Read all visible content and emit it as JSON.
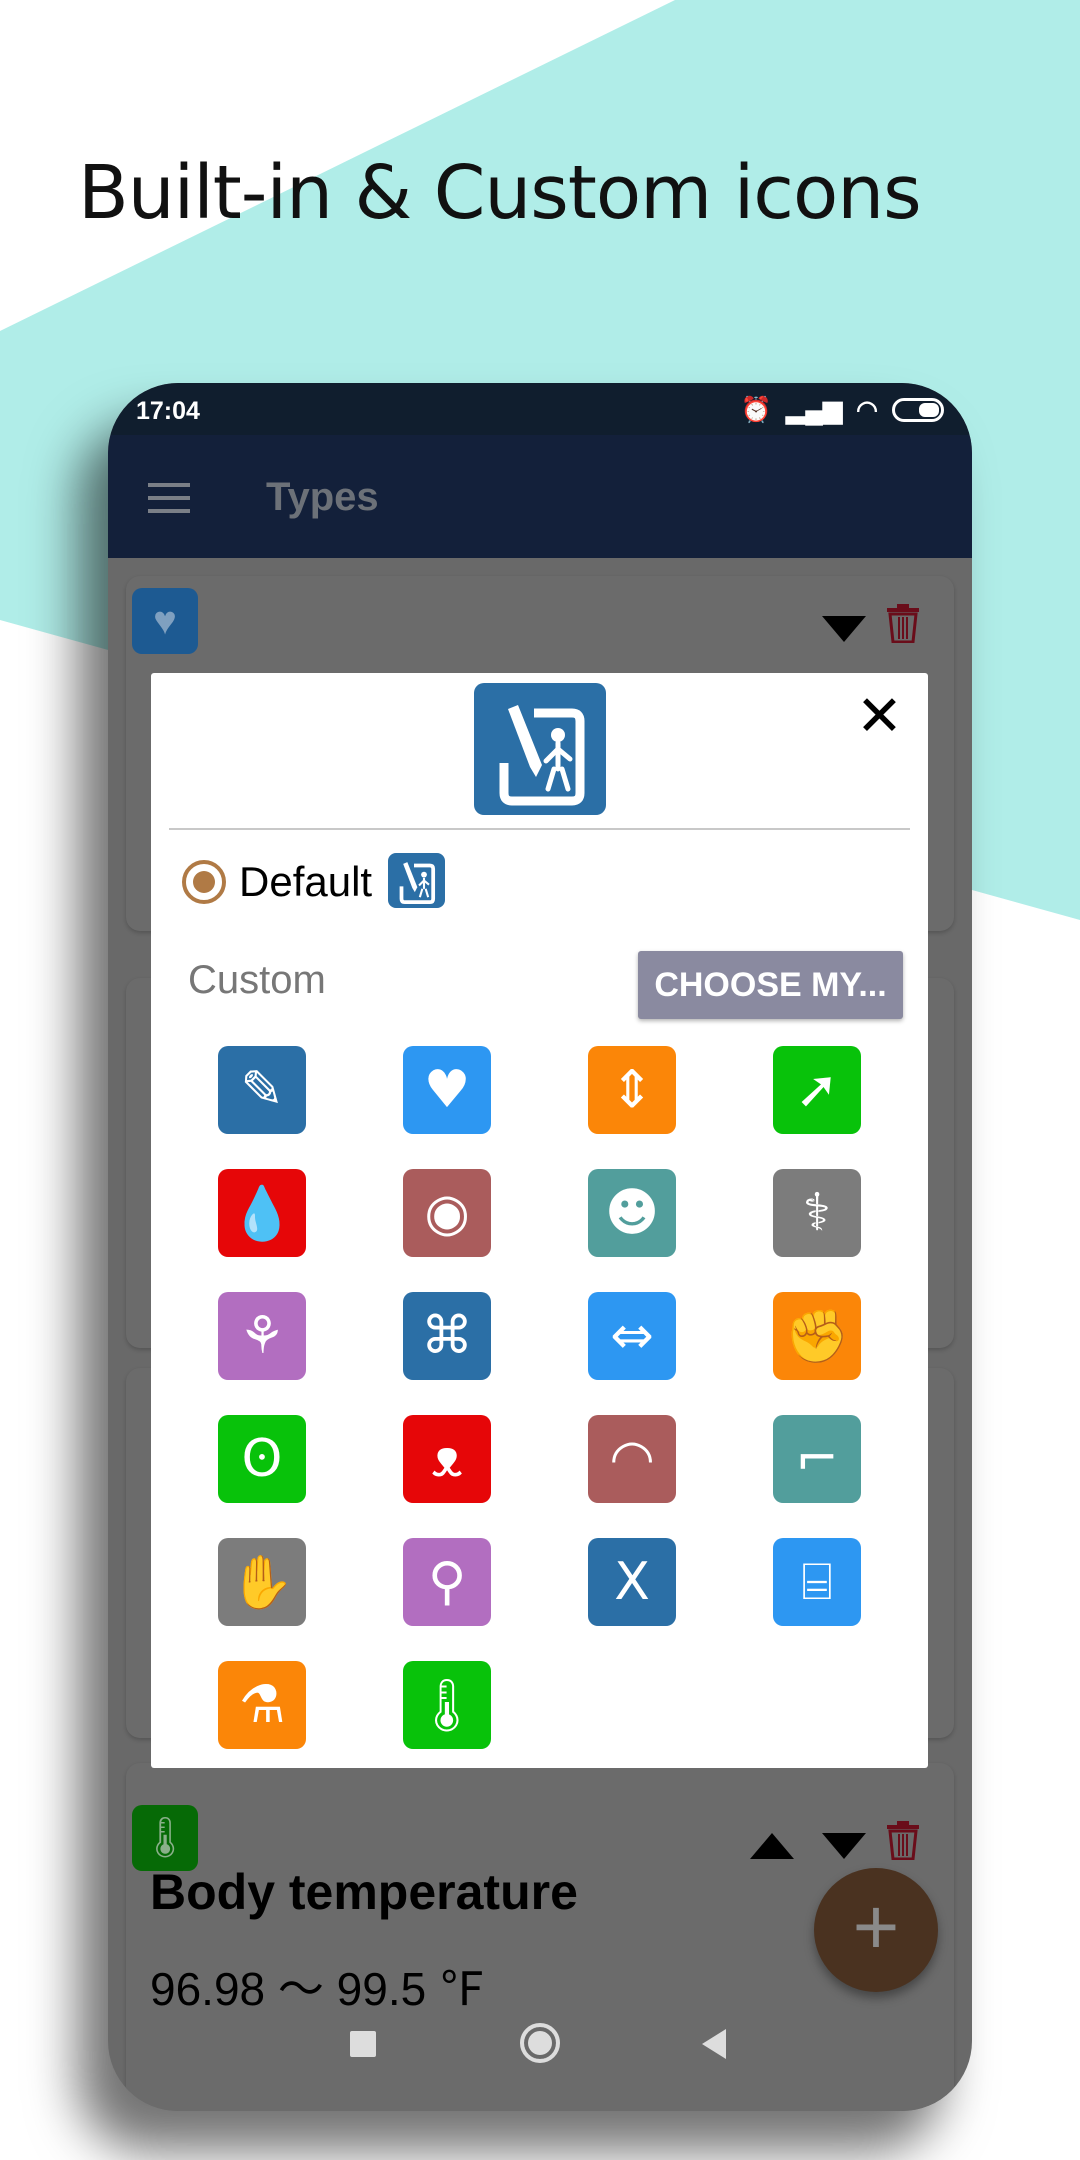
{
  "headline": "Built-in & Custom icons",
  "colors": {
    "teal_band": "#b0ede8",
    "app_bar": "#13203a",
    "status_bar": "#101e2e",
    "radio": "#b07a45",
    "fab": "#4a3220",
    "trash": "#6a0d1a"
  },
  "status_bar": {
    "time": "17:04",
    "icons": [
      "alarm-icon",
      "signal-icon",
      "wifi-icon",
      "battery-icon"
    ]
  },
  "app_bar": {
    "title": "Types",
    "menu_icon": "hamburger-icon"
  },
  "dialog": {
    "close_label": "✕",
    "default_label": "Default",
    "custom_label": "Custom",
    "choose_button": "CHOOSE MY...",
    "icons": [
      {
        "name": "body-chart",
        "color": "#2b6fa6",
        "glyph": "✎"
      },
      {
        "name": "heart-rate",
        "color": "#2d97f2",
        "glyph": "♥"
      },
      {
        "name": "height",
        "color": "#fb8608",
        "glyph": "⇕"
      },
      {
        "name": "compass",
        "color": "#08c20a",
        "glyph": "➚"
      },
      {
        "name": "blood-drops",
        "color": "#e60608",
        "glyph": "💧"
      },
      {
        "name": "eye",
        "color": "#aa5c5c",
        "glyph": "◉"
      },
      {
        "name": "head",
        "color": "#529e9c",
        "glyph": "☻"
      },
      {
        "name": "organs",
        "color": "#7c7c7c",
        "glyph": "⚕"
      },
      {
        "name": "lungs",
        "color": "#b26ec0",
        "glyph": "⚘"
      },
      {
        "name": "intestine",
        "color": "#2b6fa6",
        "glyph": "⌘"
      },
      {
        "name": "waist",
        "color": "#2d97f2",
        "glyph": "⇔"
      },
      {
        "name": "muscle",
        "color": "#fb8608",
        "glyph": "✊"
      },
      {
        "name": "ear",
        "color": "#08c20a",
        "glyph": "ʘ"
      },
      {
        "name": "nose",
        "color": "#e60608",
        "glyph": "ᴥ"
      },
      {
        "name": "lips",
        "color": "#aa5c5c",
        "glyph": "◠"
      },
      {
        "name": "leg",
        "color": "#529e9c",
        "glyph": "⌐"
      },
      {
        "name": "hand",
        "color": "#7c7c7c",
        "glyph": "✋"
      },
      {
        "name": "syringe",
        "color": "#b26ec0",
        "glyph": "⚲"
      },
      {
        "name": "xray",
        "color": "#2b6fa6",
        "glyph": "X"
      },
      {
        "name": "scanner",
        "color": "#2d97f2",
        "glyph": "⌸"
      },
      {
        "name": "test-tube",
        "color": "#fb8608",
        "glyph": "⚗"
      },
      {
        "name": "body-temperature",
        "color": "#08c20a",
        "glyph": "🌡"
      }
    ]
  },
  "cards": [
    {
      "icon": "heart-rate-icon",
      "icon_color": "#1d5a92"
    },
    {
      "icon": "body-temperature-icon",
      "icon_color": "#066a06",
      "title": "Body temperature",
      "range": "96.98 〜 99.5 ℉"
    }
  ],
  "fab_label": "+"
}
